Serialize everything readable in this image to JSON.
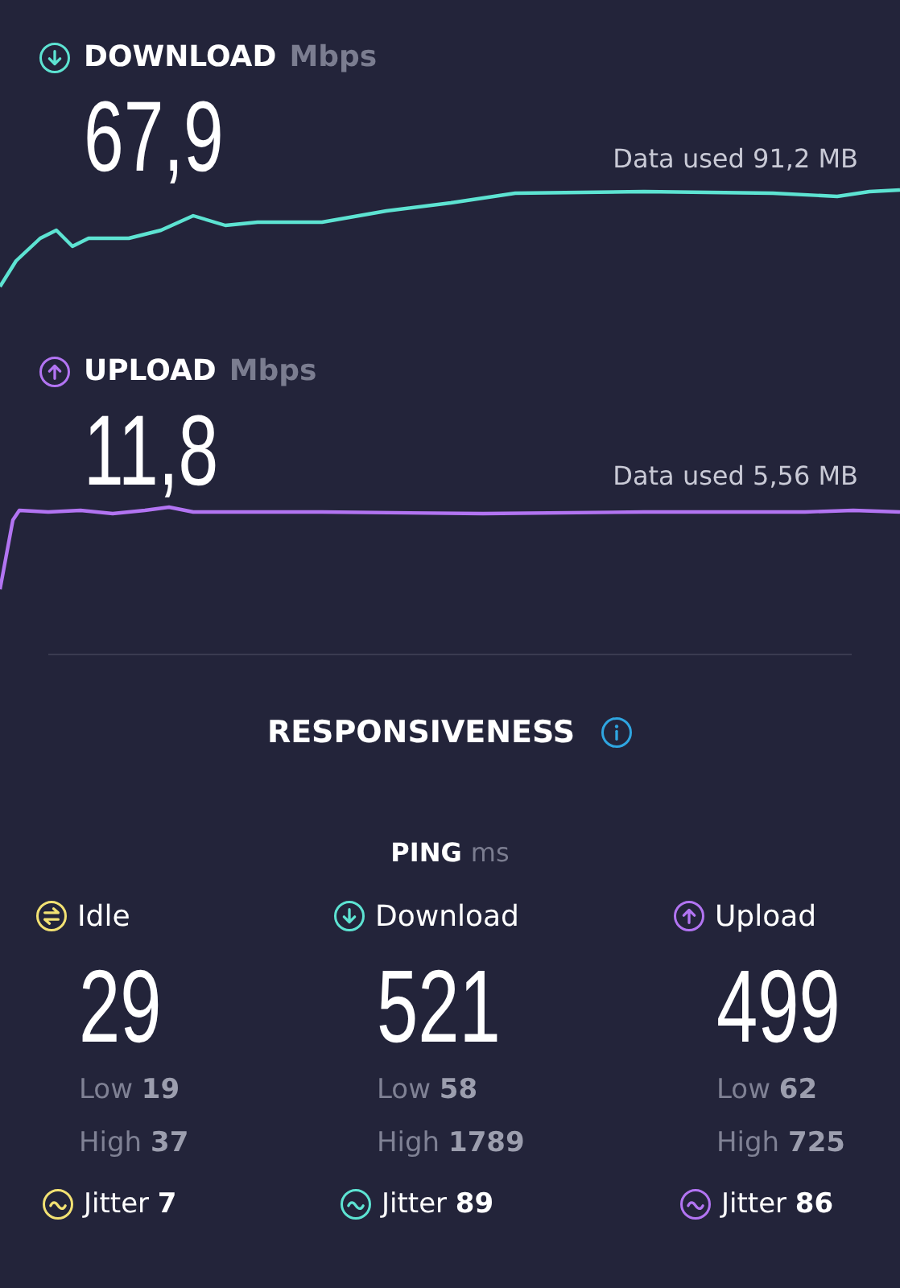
{
  "tests": [
    {
      "kind": "download",
      "label": "DOWNLOAD",
      "unit": "Mbps",
      "value": "67,9",
      "data_used": "Data used 91,2 MB",
      "color": "#5de3d2"
    },
    {
      "kind": "upload",
      "label": "UPLOAD",
      "unit": "Mbps",
      "value": "11,8",
      "data_used": "Data used 5,56 MB",
      "color": "#b274f2"
    }
  ],
  "responsiveness": {
    "title": "RESPONSIVENESS"
  },
  "ping": {
    "label": "PING",
    "unit": "ms",
    "columns": [
      {
        "kind": "idle",
        "label": "Idle",
        "value": "29",
        "low": "Low **19**",
        "high": "High **37**",
        "jitter": "Jitter **7**",
        "color": "#f2e173"
      },
      {
        "kind": "download",
        "label": "Download",
        "value": "521",
        "low": "Low **58**",
        "high": "High **1789**",
        "jitter": "Jitter **89**",
        "color": "#5de3d2"
      },
      {
        "kind": "upload",
        "label": "Upload",
        "value": "499",
        "low": "Low **62**",
        "high": "High **725**",
        "jitter": "Jitter **86**",
        "color": "#b274f2"
      }
    ]
  }
}
